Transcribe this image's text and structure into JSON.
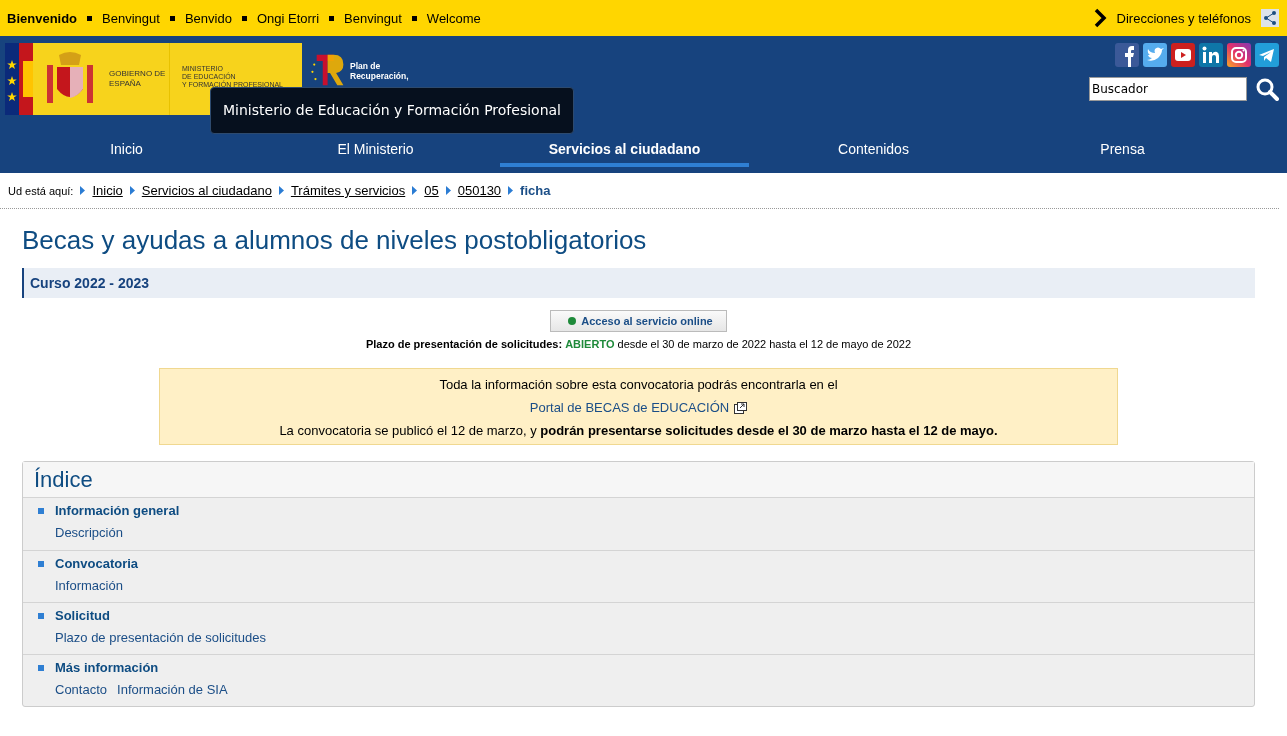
{
  "top_bar": {
    "greetings": [
      {
        "label": "Bienvenido",
        "selected": true
      },
      {
        "label": "Benvingut",
        "selected": false
      },
      {
        "label": "Benvido",
        "selected": false
      },
      {
        "label": "Ongi Etorri",
        "selected": false
      },
      {
        "label": "Benvingut",
        "selected": false
      },
      {
        "label": "Welcome",
        "selected": false
      }
    ],
    "directions_link": "Direcciones y teléfonos"
  },
  "header": {
    "logo_gov": "GOBIERNO DE ESPAÑA",
    "logo_ministry": [
      "MINISTERIO",
      "DE EDUCACIÓN",
      "Y FORMACIÓN PROFESIONAL"
    ],
    "logo_plan": [
      "Plan de",
      "Recuperación,"
    ],
    "tooltip": "Ministerio de Educación y Formación Profesional",
    "search": {
      "value": "Buscador"
    }
  },
  "nav": [
    {
      "label": "Inicio",
      "selected": false
    },
    {
      "label": "El Ministerio",
      "selected": false
    },
    {
      "label": "Servicios al ciudadano",
      "selected": true
    },
    {
      "label": "Contenidos",
      "selected": false
    },
    {
      "label": "Prensa",
      "selected": false
    }
  ],
  "breadcrumb": {
    "prefix": "Ud está aquí:",
    "items": [
      "Inicio",
      "Servicios al ciudadano",
      "Trámites y servicios",
      "05",
      "050130"
    ],
    "current": "ficha"
  },
  "title": "Becas y ayudas a alumnos de niveles postobligatorios",
  "course": "Curso 2022 - 2023",
  "online_button": "Acceso al servicio online",
  "deadline": {
    "label": "Plazo de presentación de solicitudes:",
    "status": "ABIERTO",
    "text": "desde el 30 de marzo de 2022 hasta el 12 de mayo de 2022"
  },
  "notice": {
    "line1": "Toda la información sobre esta convocatoria podrás encontrarla en el",
    "link": "Portal de BECAS de EDUCACIÓN",
    "line3": "La convocatoria se publicó el 12 de marzo, y **podrán presentarse solicitudes desde el 30 de marzo hasta el 12 de mayo.**"
  },
  "index": {
    "title": "Índice",
    "sections": [
      {
        "title": "Información general",
        "links": [
          "Descripción"
        ]
      },
      {
        "title": "Convocatoria",
        "links": [
          "Información"
        ]
      },
      {
        "title": "Solicitud",
        "links": [
          "Plazo de presentación de solicitudes"
        ]
      },
      {
        "title": "Más información",
        "links": [
          "Contacto",
          "Información de SIA"
        ]
      }
    ]
  }
}
